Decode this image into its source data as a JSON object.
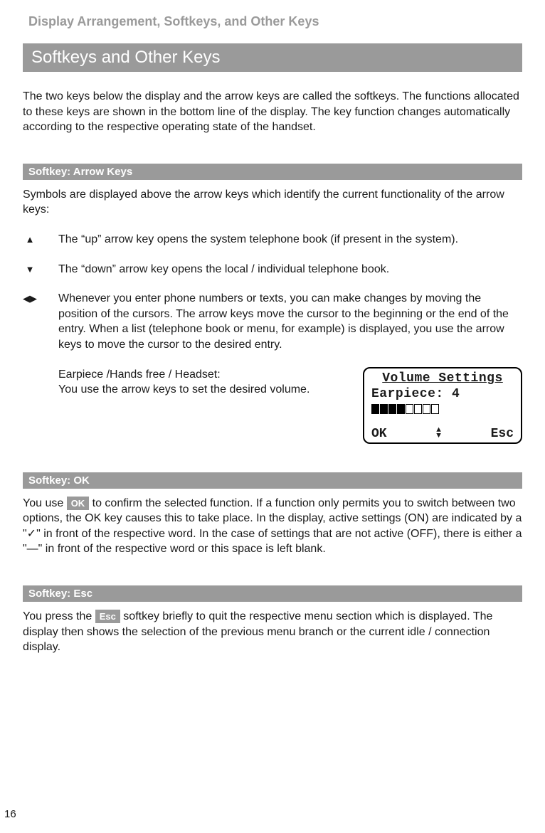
{
  "header": {
    "title": "Display Arrangement, Softkeys, and Other Keys"
  },
  "main_heading": "Softkeys and Other Keys",
  "intro": "The two keys below the display and the arrow keys are called the softkeys. The functions allocated to these keys are shown in the bottom line of the display. The key function changes automatically according to the respective operating state of the handset.",
  "section_arrow": {
    "heading": "Softkey: Arrow Keys",
    "intro": "Symbols are displayed above the arrow keys which identify the current functionality of the arrow keys:",
    "items": [
      {
        "icon": "▲",
        "text": "The “up” arrow key opens the system telephone book (if present in the system)."
      },
      {
        "icon": "▼",
        "text": "The “down” arrow key opens the local / individual telephone book."
      },
      {
        "icon": "◀▶",
        "text": "Whenever you enter phone numbers or texts, you can make changes by moving the position of the cursors. The arrow keys move the cursor to the beginning or the end of the entry. When a list (telephone book or menu, for example) is displayed, you use the arrow keys to move the cursor to the desired entry."
      }
    ],
    "volume_block": {
      "text_line1": "Earpiece /Hands free / Headset:",
      "text_line2": "You use the arrow keys to set the desired volume."
    }
  },
  "lcd": {
    "title": "Volume Settings",
    "line1": "Earpiece: 4",
    "filled": 4,
    "total": 8,
    "soft_left": "OK",
    "soft_right": "Esc"
  },
  "section_ok": {
    "heading": "Softkey: OK",
    "pre": "You use ",
    "chip": "OK",
    "post": " to confirm the selected function. If a function only permits you to switch between two options, the OK key causes this to take place. In the display, active settings (ON) are indicated by a \"✓\" in front of the respective word. In the case of settings that are not active (OFF), there is either a \"—\"  in front of the respective word or this space is left blank."
  },
  "section_esc": {
    "heading": "Softkey: Esc",
    "pre": "You press the ",
    "chip": "Esc",
    "post": "  softkey briefly to quit the respective menu section which is displayed. The display then shows the selection of the previous menu branch or the current idle / connection display."
  },
  "page_number": "16"
}
